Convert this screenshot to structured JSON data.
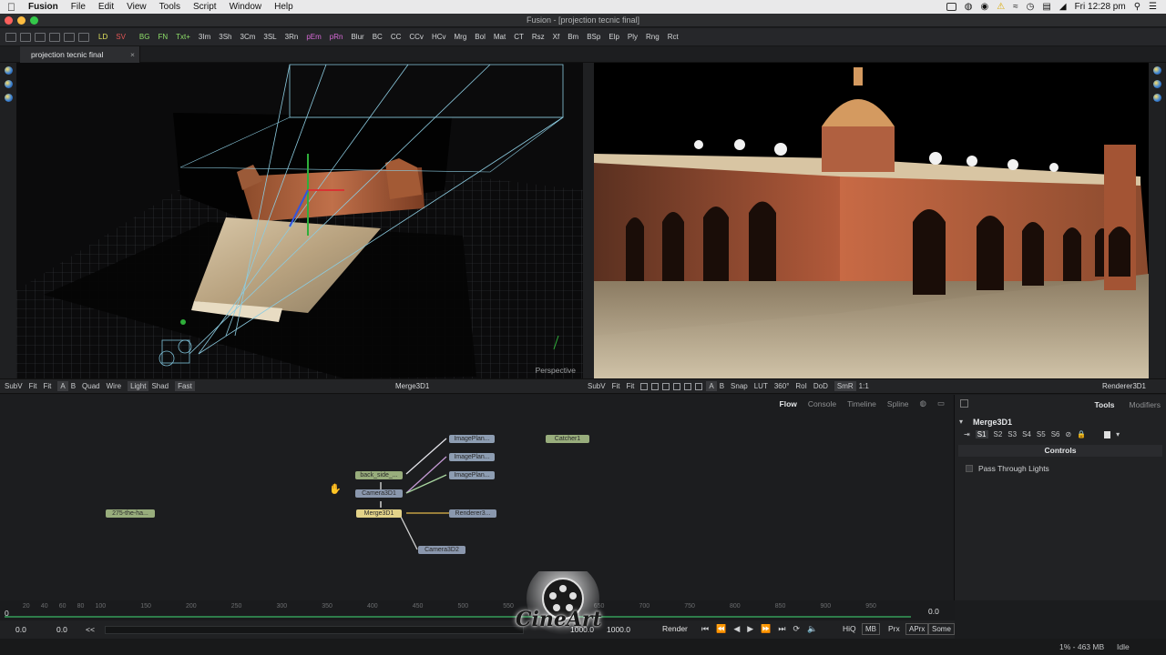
{
  "menubar": {
    "app": "Fusion",
    "items": [
      "File",
      "Edit",
      "View",
      "Tools",
      "Script",
      "Window",
      "Help"
    ],
    "clock": "Fri 12:28 pm"
  },
  "window": {
    "title": "Fusion - [projection tecnic final]"
  },
  "toolbar": {
    "buttons": [
      "LD",
      "SV",
      "BG",
      "FN",
      "Txt+",
      "3Im",
      "3Sh",
      "3Cm",
      "3SL",
      "3Rn",
      "pEm",
      "pRn",
      "Blur",
      "BC",
      "CC",
      "CCv",
      "HCv",
      "Mrg",
      "Bol",
      "Mat",
      "CT",
      "Rsz",
      "Xf",
      "Bm",
      "BSp",
      "Elp",
      "Ply",
      "Rng",
      "Rct"
    ],
    "colors": {
      "LD": "#e2e45e",
      "SV": "#e25656",
      "BG": "#8fe06a",
      "FN": "#8fe06a",
      "Txt+": "#8fe06a",
      "pEm": "#d86ad8",
      "pRn": "#d86ad8"
    }
  },
  "doc_tab": {
    "label": "projection tecnic final",
    "close": "×"
  },
  "viewer_left": {
    "label": "Perspective",
    "bar": {
      "subv": "SubV",
      "fit1": "Fit",
      "fit2": "Fit",
      "a": "A",
      "b": "B",
      "quad": "Quad",
      "wire": "Wire",
      "light": "Light",
      "shad": "Shad",
      "fast": "Fast",
      "node": "Merge3D1"
    }
  },
  "viewer_right": {
    "bar": {
      "subv": "SubV",
      "fit1": "Fit",
      "fit2": "Fit",
      "a": "A",
      "b": "B",
      "snap": "Snap",
      "lut": "LUT",
      "deg": "360°",
      "roi": "RoI",
      "dod": "DoD",
      "smr": "SmR",
      "ratio": "1:1",
      "node": "Renderer3D1"
    }
  },
  "flow": {
    "tabs": [
      "Flow",
      "Console",
      "Timeline",
      "Spline"
    ],
    "active_tab": "Flow",
    "nodes": {
      "img1": "ImagePlan...",
      "img2": "ImagePlan...",
      "img3": "ImagePlan...",
      "catcher": "Catcher1",
      "backside": "back_side_...",
      "camera1": "Camera3D1",
      "merge": "Merge3D1",
      "renderer": "Renderer3...",
      "camera2": "Camera3D2",
      "loader": "275-the-ha..."
    }
  },
  "inspector": {
    "tabs": [
      "Tools",
      "Modifiers"
    ],
    "active_tab": "Tools",
    "tool": "Merge3D1",
    "slots": [
      "S1",
      "S2",
      "S3",
      "S4",
      "S5",
      "S6"
    ],
    "section": "Controls",
    "checkbox": "Pass Through Lights"
  },
  "timeline": {
    "ticks": [
      "0",
      "20",
      "40",
      "60",
      "80",
      "100",
      "150",
      "200",
      "250",
      "300",
      "350",
      "400",
      "450",
      "500",
      "550",
      "600",
      "650",
      "700",
      "750",
      "800",
      "850",
      "900",
      "950"
    ],
    "current": "0.0"
  },
  "transport": {
    "start": "0.0",
    "render_start": "0.0",
    "back": "<<",
    "render_end": "1000.0",
    "end": "1000.0",
    "render": "Render",
    "hiq": "HiQ",
    "mb": "MB",
    "prx": "Prx",
    "aprx": "APrx",
    "some": "Some"
  },
  "status": {
    "memory": "1% - 463 MB",
    "state": "Idle"
  },
  "watermark": "CineArt"
}
